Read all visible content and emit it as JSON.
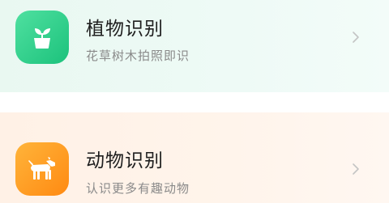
{
  "items": [
    {
      "title": "植物识别",
      "subtitle": "花草树木拍照即识",
      "icon": "plant-pot-icon",
      "accent": "#1cc27c"
    },
    {
      "title": "动物识别",
      "subtitle": "认识更多有趣动物",
      "icon": "dog-icon",
      "accent": "#ff8a12"
    }
  ]
}
